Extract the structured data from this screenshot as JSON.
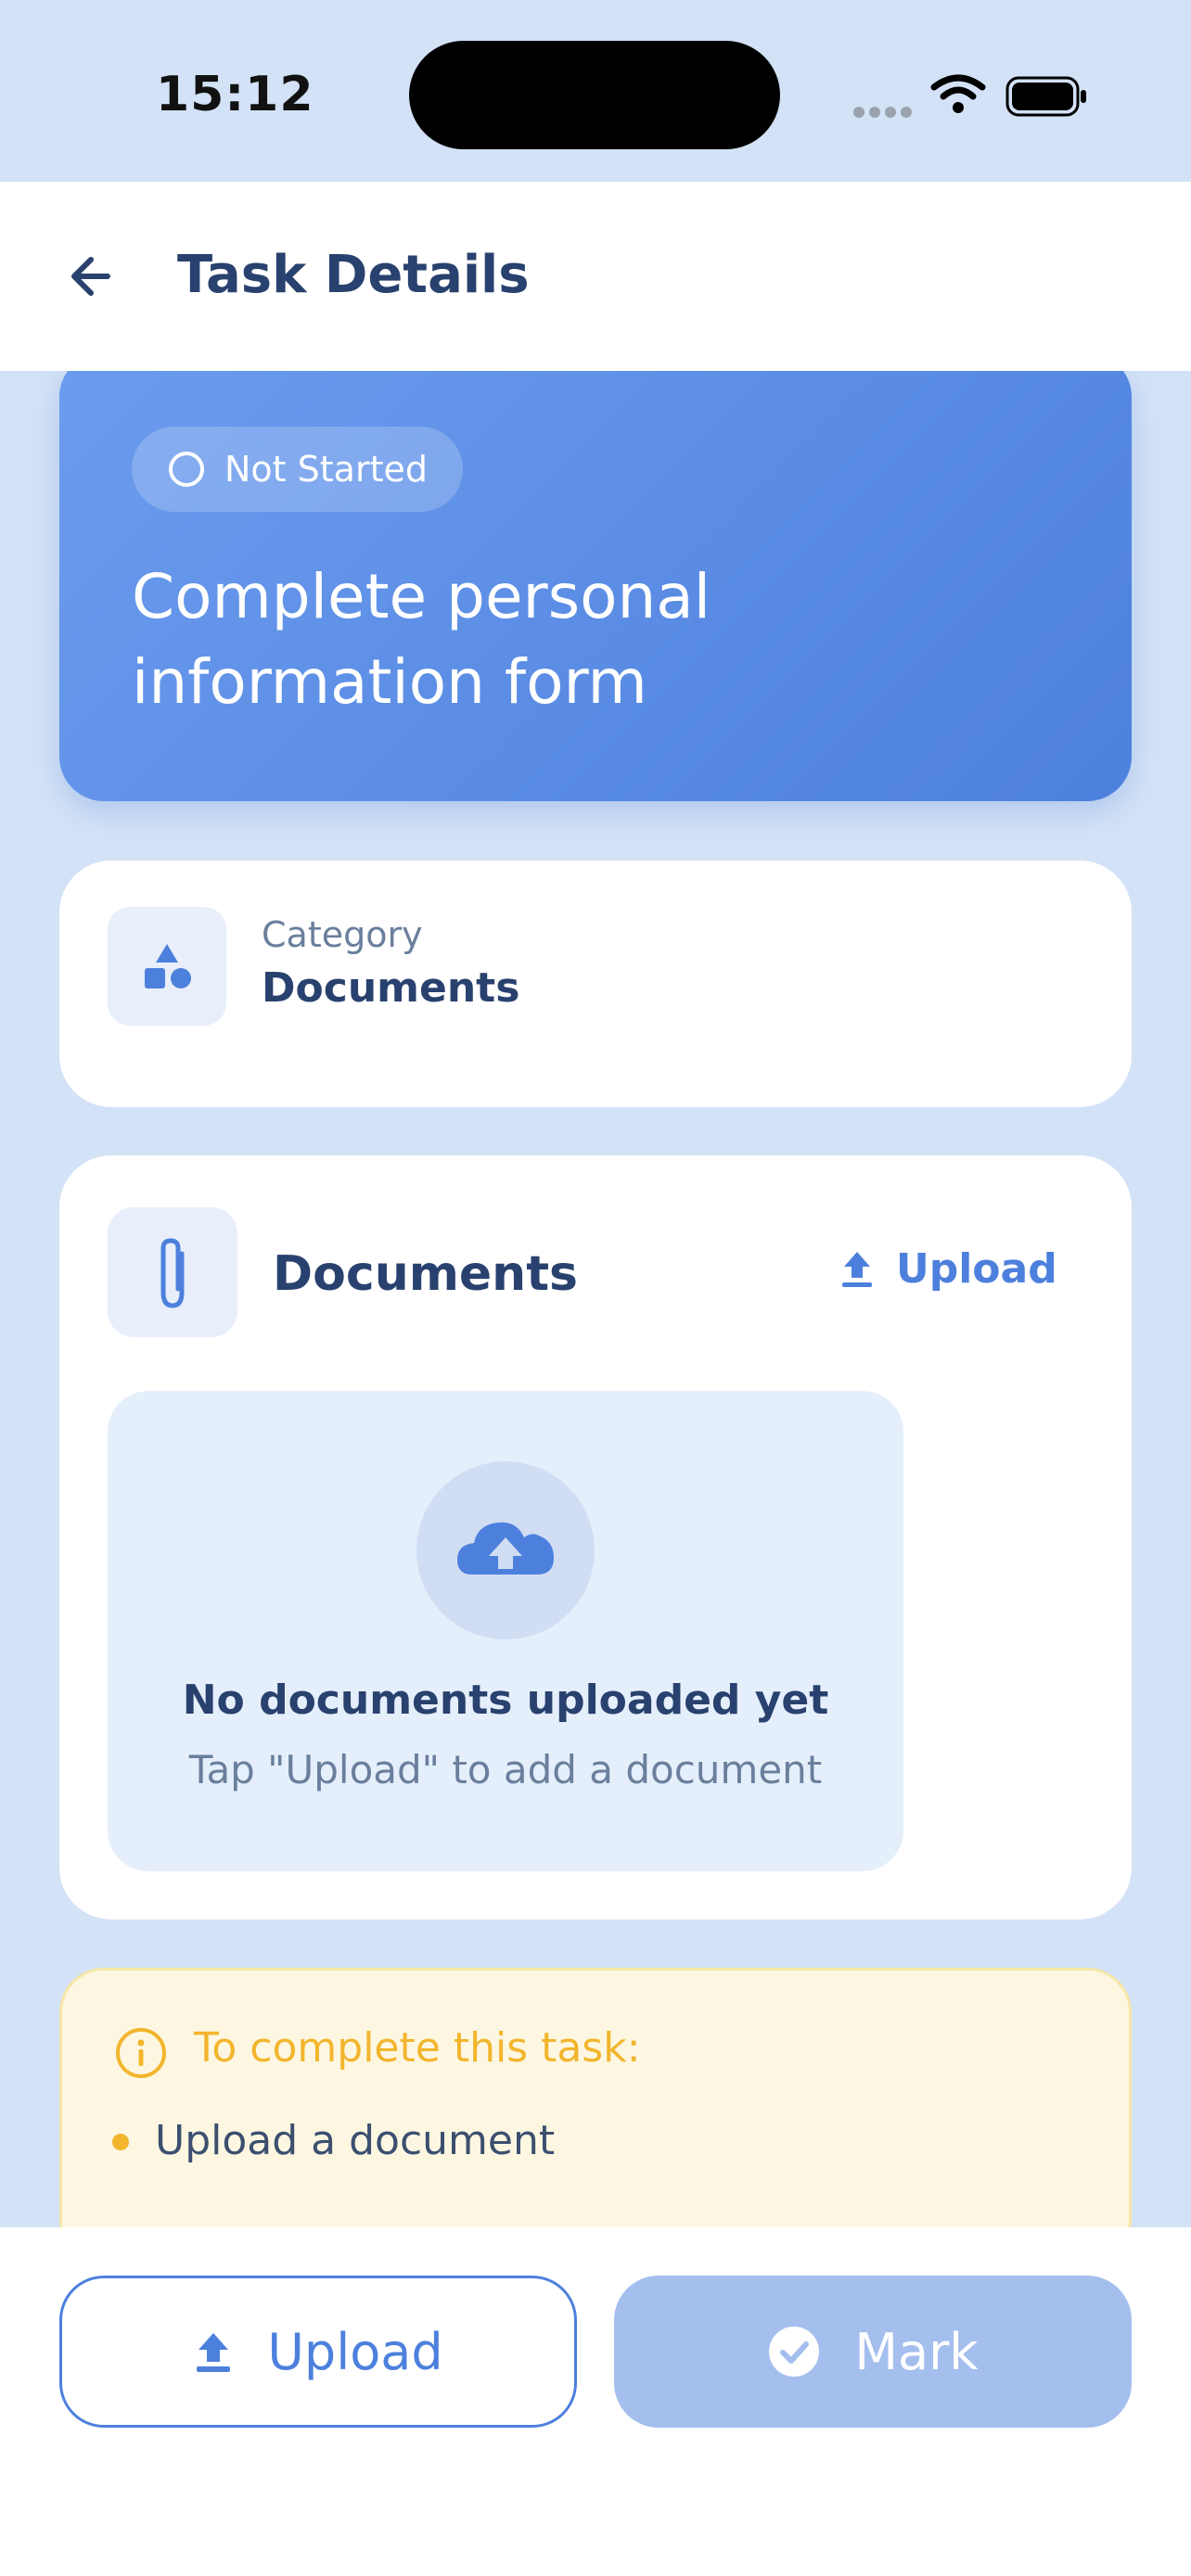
{
  "status_bar": {
    "time": "15:12"
  },
  "header": {
    "title": "Task Details"
  },
  "task": {
    "status": "Not Started",
    "title": "Complete personal information form"
  },
  "category": {
    "label": "Category",
    "value": "Documents"
  },
  "documents": {
    "title": "Documents",
    "upload_label": "Upload",
    "empty_title": "No documents uploaded yet",
    "empty_subtitle": "Tap \"Upload\" to add a document"
  },
  "requirements": {
    "title": "To complete this task:",
    "items": [
      "Upload a document"
    ]
  },
  "actions": {
    "upload_label": "Upload",
    "mark_label": "Mark"
  },
  "colors": {
    "accent": "#4d80dd",
    "background": "#d3e2f6",
    "warning": "#f2b52c",
    "disabled": "#a4bfee"
  }
}
